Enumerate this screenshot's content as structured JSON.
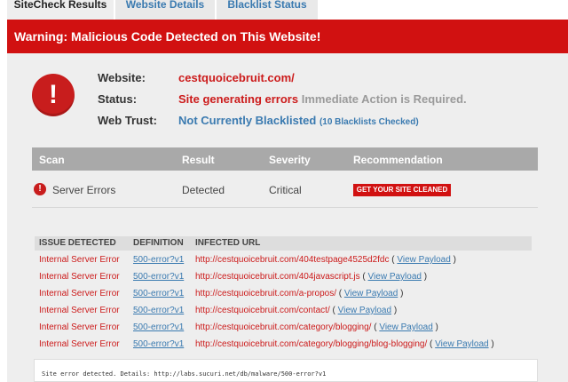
{
  "tabs": [
    {
      "label": "SiteCheck Results",
      "active": true
    },
    {
      "label": "Website Details",
      "active": false
    },
    {
      "label": "Blacklist Status",
      "active": false
    }
  ],
  "banner": {
    "text": "Warning: Malicious Code Detected on This Website!"
  },
  "warning_icon": {
    "glyph": "!",
    "icon": "exclamation-icon",
    "color": "#c81d1d"
  },
  "summary": {
    "website_label": "Website:",
    "website_value": "cestquoicebruit.com/",
    "status_label": "Status:",
    "status_value": "Site generating errors",
    "status_note": "Immediate Action is Required.",
    "trust_label": "Web Trust:",
    "trust_value": "Not Currently Blacklisted",
    "trust_note": "(10 Blacklists Checked)"
  },
  "scan_table": {
    "headers": [
      "Scan",
      "Result",
      "Severity",
      "Recommendation"
    ],
    "row": {
      "scan": "Server Errors",
      "result": "Detected",
      "severity": "Critical",
      "recommendation": "GET YOUR SITE CLEANED"
    }
  },
  "issues": {
    "headers": [
      "ISSUE DETECTED",
      "DEFINITION",
      "INFECTED URL"
    ],
    "view_payload_label": "View Payload",
    "rows": [
      {
        "issue": "Internal Server Error",
        "definition": "500-error?v1",
        "url": "http://cestquoicebruit.com/404testpage4525d2fdc"
      },
      {
        "issue": "Internal Server Error",
        "definition": "500-error?v1",
        "url": "http://cestquoicebruit.com/404javascript.js"
      },
      {
        "issue": "Internal Server Error",
        "definition": "500-error?v1",
        "url": "http://cestquoicebruit.com/a-propos/"
      },
      {
        "issue": "Internal Server Error",
        "definition": "500-error?v1",
        "url": "http://cestquoicebruit.com/contact/"
      },
      {
        "issue": "Internal Server Error",
        "definition": "500-error?v1",
        "url": "http://cestquoicebruit.com/category/blogging/"
      },
      {
        "issue": "Internal Server Error",
        "definition": "500-error?v1",
        "url": "http://cestquoicebruit.com/category/blogging/blog-blogging/"
      }
    ]
  },
  "detail": {
    "text": "Site error detected. Details: http://labs.sucuri.net/db/malware/500-error?v1"
  },
  "colors": {
    "accent_red": "#d11111",
    "link_blue": "#3a7ab0",
    "panel_grey": "#eeeeee"
  }
}
